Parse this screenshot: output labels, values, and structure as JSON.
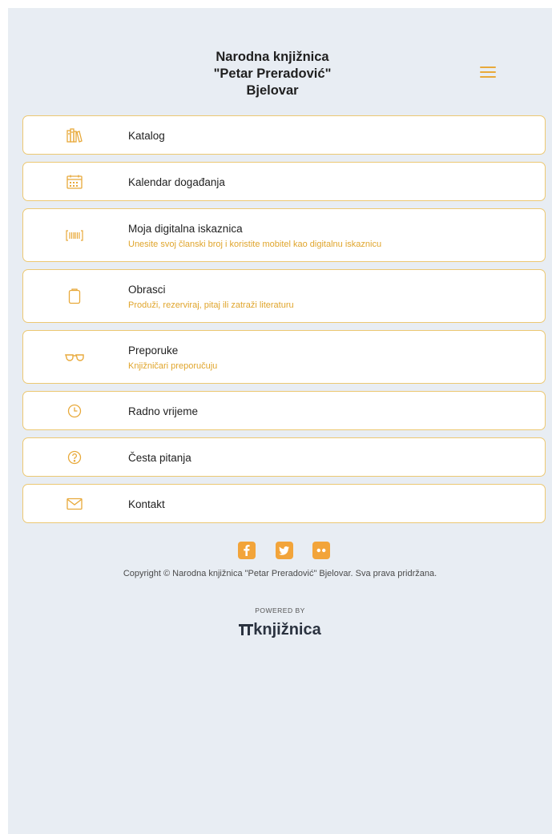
{
  "header": {
    "title_line1": "Narodna knjižnica",
    "title_line2": "\"Petar Preradović\"",
    "title_line3": "Bjelovar",
    "menu_icon": "hamburger-menu-icon"
  },
  "menu": [
    {
      "label": "Katalog",
      "subtitle": "",
      "icon": "books-icon"
    },
    {
      "label": "Kalendar događanja",
      "subtitle": "",
      "icon": "calendar-icon"
    },
    {
      "label": "Moja digitalna iskaznica",
      "subtitle": "Unesite svoj članski broj i koristite mobitel kao digitalnu iskaznicu",
      "icon": "barcode-card-icon"
    },
    {
      "label": "Obrasci",
      "subtitle": "Produži, rezerviraj, pitaj ili zatraži literaturu",
      "icon": "clipboard-icon"
    },
    {
      "label": "Preporuke",
      "subtitle": "Knjižničari preporučuju",
      "icon": "glasses-icon"
    },
    {
      "label": "Radno vrijeme",
      "subtitle": "",
      "icon": "clock-icon"
    },
    {
      "label": "Česta pitanja",
      "subtitle": "",
      "icon": "question-icon"
    },
    {
      "label": "Kontakt",
      "subtitle": "",
      "icon": "envelope-icon"
    }
  ],
  "footer": {
    "social": [
      "facebook-icon",
      "twitter-icon",
      "flickr-icon"
    ],
    "copyright": "Copyright © Narodna knjižnica \"Petar Preradović\" Bjelovar. Sva prava pridržana.",
    "powered_by": "POWERED BY",
    "brand": "knjižnica"
  },
  "colors": {
    "accent": "#e8a93a",
    "card_border": "#ecc872",
    "subtitle": "#e0a52c",
    "background": "#e8edf3"
  }
}
